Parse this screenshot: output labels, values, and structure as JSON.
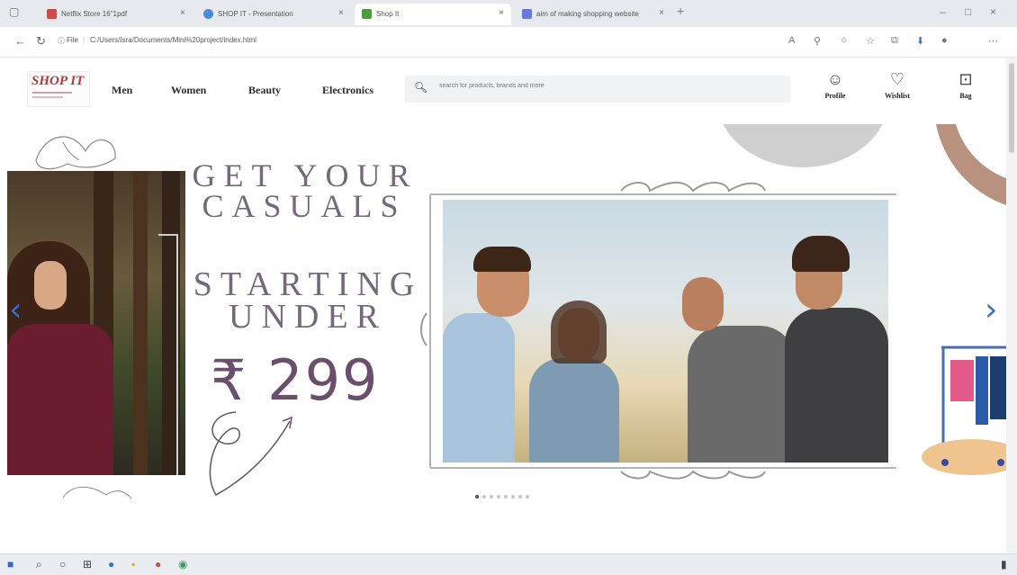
{
  "browser": {
    "tabs": [
      {
        "title": "Netflix Store 16\"1pdf",
        "favicon_color": "#d04a4a"
      },
      {
        "title": "SHOP IT - Presentation",
        "favicon_color": "#4a8ad8"
      },
      {
        "title": "Shop It",
        "favicon_color": "#4f9a3f"
      },
      {
        "title": "aim of making shopping website",
        "favicon_color": "#6a7ad8"
      }
    ],
    "new_tab_label": "+",
    "url_prefix": "File",
    "url": "C:/Users/Isra/Documents/Mini%20project/index.html"
  },
  "site": {
    "logo_text": "SHOP IT",
    "nav": [
      "Men",
      "Women",
      "Beauty",
      "Electronics"
    ],
    "search_placeholder": "search for products, brands and more",
    "actions": [
      {
        "label": "Profile",
        "icon": "profile-icon",
        "glyph": "☺"
      },
      {
        "label": "Wishlist",
        "icon": "wishlist-icon",
        "glyph": "♡"
      },
      {
        "label": "Bag",
        "icon": "bag-icon",
        "glyph": "⊡"
      }
    ]
  },
  "hero": {
    "line1": "GET YOUR",
    "line2": "CASUALS",
    "line3": "STARTING",
    "line4": "UNDER",
    "price": "₹ 299",
    "prev_label": "‹",
    "next_label": "›",
    "slide_count": 8,
    "active_slide": 0
  },
  "colors": {
    "accent_text": "#74687a",
    "price_text": "#6a4f6c",
    "arrow": "#3a6fc8",
    "logo": "#b03a3a"
  }
}
